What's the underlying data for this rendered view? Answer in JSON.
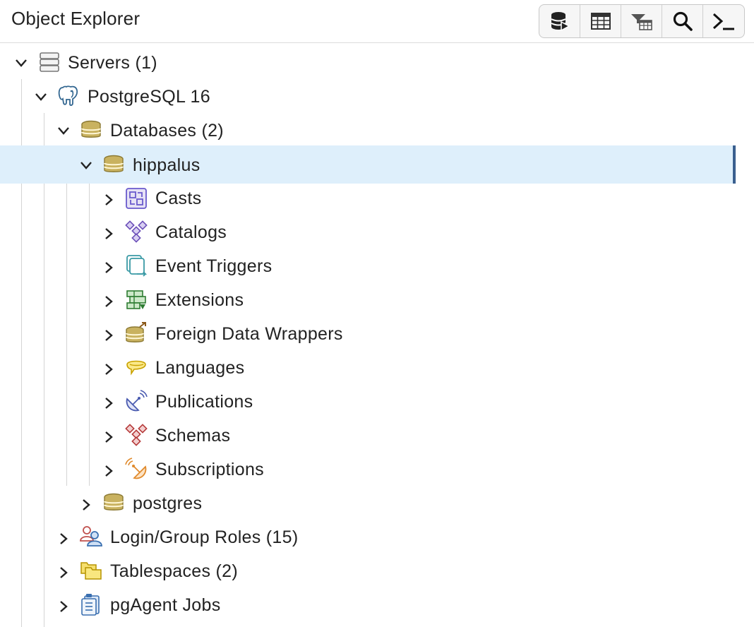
{
  "panel": {
    "title": "Object Explorer"
  },
  "toolbar": [
    {
      "name": "query-tool-button",
      "icon": "database-play-icon"
    },
    {
      "name": "view-data-button",
      "icon": "table-grid-icon"
    },
    {
      "name": "filtered-rows-button",
      "icon": "filter-table-icon"
    },
    {
      "name": "search-objects-button",
      "icon": "search-icon"
    },
    {
      "name": "psql-tool-button",
      "icon": "terminal-icon"
    }
  ],
  "tree": {
    "servers": "Servers (1)",
    "server": "PostgreSQL 16",
    "databases": "Databases (2)",
    "db_selected": "hippalus",
    "children": [
      "Casts",
      "Catalogs",
      "Event Triggers",
      "Extensions",
      "Foreign Data Wrappers",
      "Languages",
      "Publications",
      "Schemas",
      "Subscriptions"
    ],
    "db_other": "postgres",
    "roles": "Login/Group Roles (15)",
    "tablespaces": "Tablespaces (2)",
    "jobs": "pgAgent Jobs"
  },
  "colors": {
    "selection_bg": "#deeffb",
    "selection_bar": "#3a5f8f",
    "database_gold": "#b8a047"
  }
}
